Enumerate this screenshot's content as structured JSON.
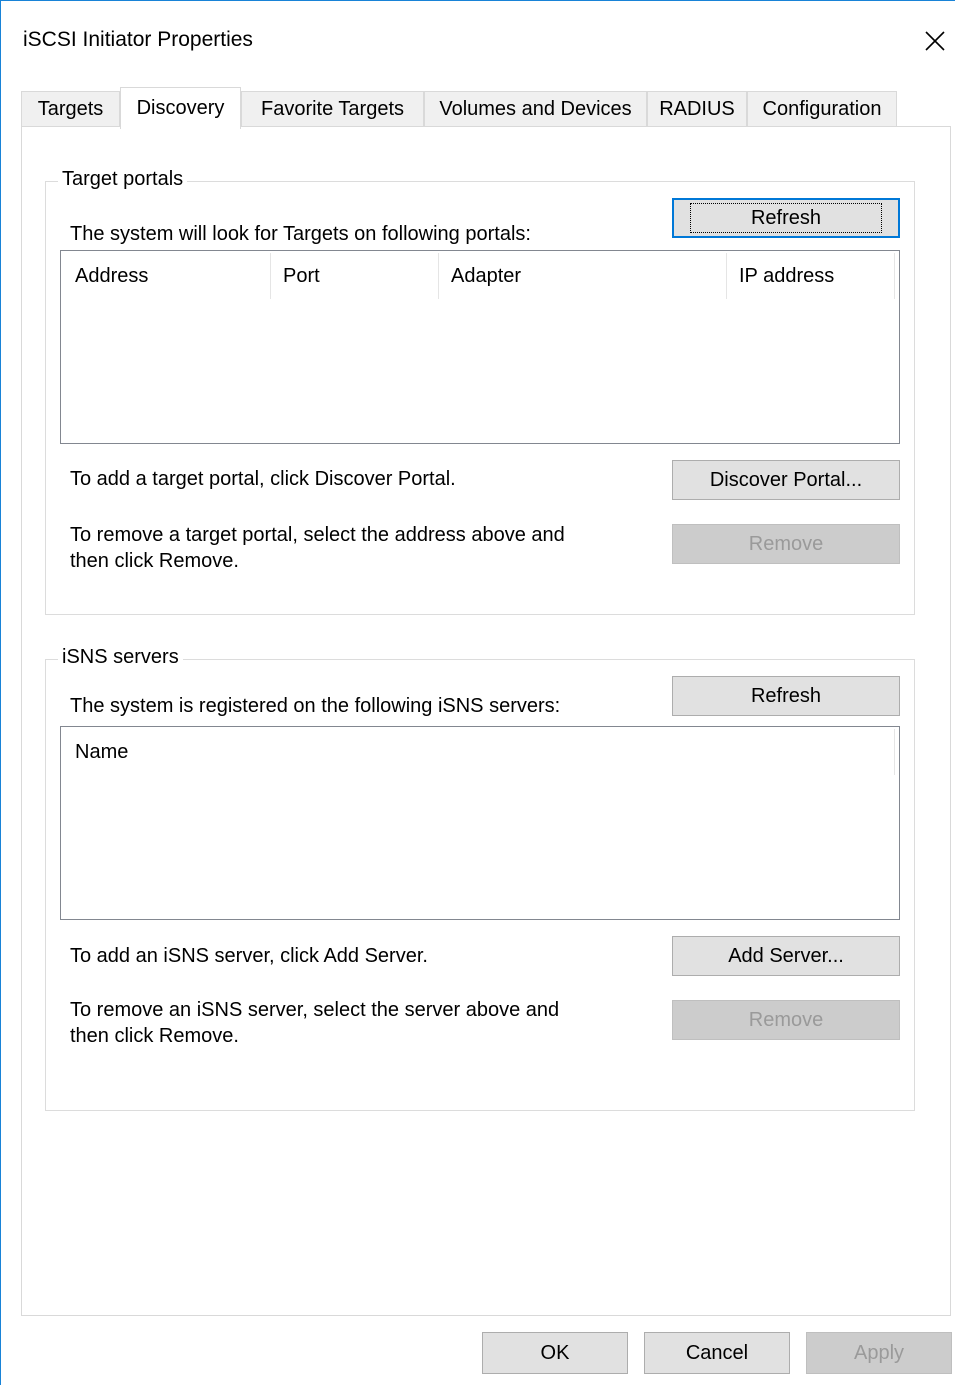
{
  "window": {
    "title": "iSCSI Initiator Properties"
  },
  "tabs": [
    {
      "label": "Targets"
    },
    {
      "label": "Discovery"
    },
    {
      "label": "Favorite Targets"
    },
    {
      "label": "Volumes and Devices"
    },
    {
      "label": "RADIUS"
    },
    {
      "label": "Configuration"
    }
  ],
  "target_portals": {
    "legend": "Target portals",
    "description": "The system will look for Targets on following portals:",
    "refresh_label": "Refresh",
    "columns": [
      "Address",
      "Port",
      "Adapter",
      "IP address"
    ],
    "add_hint": "To add a target portal, click Discover Portal.",
    "discover_label": "Discover Portal...",
    "remove_hint_1": "To remove a target portal, select the address above and",
    "remove_hint_2": "then click Remove.",
    "remove_label": "Remove"
  },
  "isns_servers": {
    "legend": "iSNS servers",
    "description": "The system is registered on the following iSNS servers:",
    "refresh_label": "Refresh",
    "columns": [
      "Name"
    ],
    "add_hint": "To add an iSNS server, click Add Server.",
    "add_label": "Add Server...",
    "remove_hint_1": "To remove an iSNS server, select the server above and",
    "remove_hint_2": "then click Remove.",
    "remove_label": "Remove"
  },
  "footer": {
    "ok_label": "OK",
    "cancel_label": "Cancel",
    "apply_label": "Apply"
  },
  "icons": {
    "close": "close-icon"
  },
  "colors": {
    "accent": "#0078d7",
    "window_border": "#1883d7",
    "disabled_text": "#9a9a9a"
  }
}
